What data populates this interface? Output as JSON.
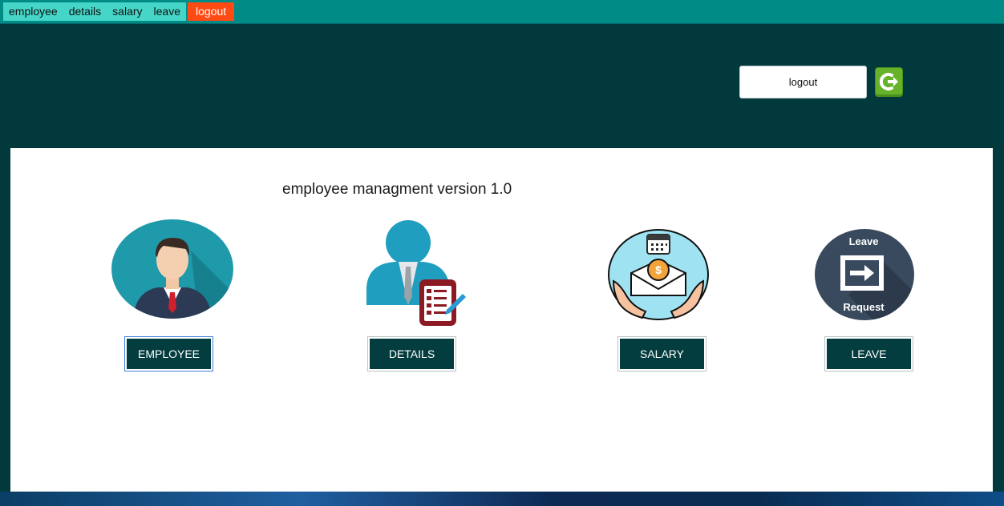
{
  "menu": {
    "items": [
      {
        "label": "employee"
      },
      {
        "label": "details"
      },
      {
        "label": "salary"
      },
      {
        "label": "leave"
      },
      {
        "label": "logout"
      }
    ],
    "active_index": 4
  },
  "header": {
    "logout_label": "logout",
    "logout_icon": "logout-arrow-icon"
  },
  "main": {
    "title": "employee managment version 1.0",
    "modules": [
      {
        "icon": "employee-avatar-icon",
        "button_label": "EMPLOYEE"
      },
      {
        "icon": "employee-details-icon",
        "button_label": "DETAILS"
      },
      {
        "icon": "salary-envelope-icon",
        "button_label": "SALARY"
      },
      {
        "icon": "leave-request-icon",
        "button_label": "LEAVE",
        "icon_text_top": "Leave",
        "icon_text_bottom": "Request"
      }
    ]
  },
  "colors": {
    "background": "#01393d",
    "menubar": "#008b86",
    "menu_item": "#45d6c8",
    "menu_active": "#ff4a14",
    "button": "#043d3f",
    "logout_icon": "#5fa524"
  }
}
